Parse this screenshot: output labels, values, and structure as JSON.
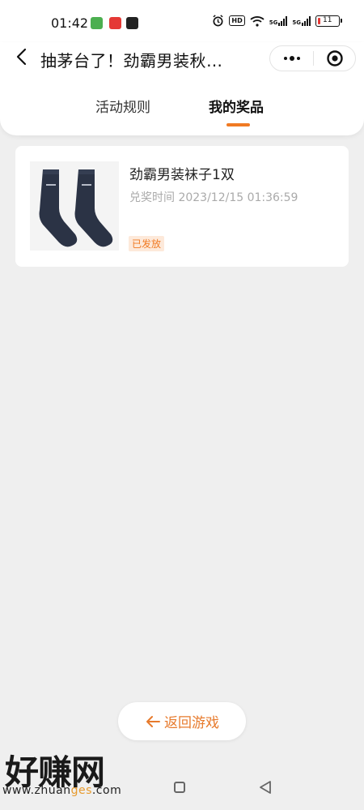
{
  "status_bar": {
    "time": "01:42",
    "hd_label": "HD",
    "signal_1": "5G",
    "signal_2": "5G",
    "battery": "11",
    "app_icons": [
      {
        "name": "messages-app-icon",
        "color": "#4caf50"
      },
      {
        "name": "record-app-icon",
        "color": "#e53935"
      },
      {
        "name": "wallet-app-icon",
        "color": "#222222"
      }
    ]
  },
  "header": {
    "title": "抽茅台了！劲霸男装秋…"
  },
  "tabs": [
    {
      "label": "活动规则",
      "active": false
    },
    {
      "label": "我的奖品",
      "active": true
    }
  ],
  "prize": {
    "name": "劲霸男装袜子1双",
    "time": "兑奖时间 2023/12/15 01:36:59",
    "status": "已发放"
  },
  "return_button": {
    "label": "返回游戏"
  },
  "watermark": {
    "title": "好赚网",
    "url_prefix": "www.zhuan",
    "url_highlight": "ges",
    "url_suffix": ".com"
  },
  "colors": {
    "accent": "#f07a23",
    "background": "#efefef",
    "sock": "#2b3345"
  }
}
